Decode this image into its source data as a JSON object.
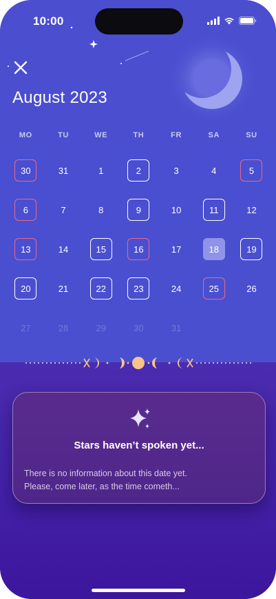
{
  "status_bar": {
    "time": "10:00"
  },
  "header": {
    "title": "August 2023",
    "close_icon": "close-icon"
  },
  "calendar": {
    "weekdays": [
      "MO",
      "TU",
      "WE",
      "TH",
      "FR",
      "SA",
      "SU"
    ],
    "weeks": [
      [
        {
          "d": "30",
          "s": "red"
        },
        {
          "d": "31",
          "s": "plain"
        },
        {
          "d": "1",
          "s": "plain"
        },
        {
          "d": "2",
          "s": "white"
        },
        {
          "d": "3",
          "s": "plain"
        },
        {
          "d": "4",
          "s": "plain"
        },
        {
          "d": "5",
          "s": "red"
        }
      ],
      [
        {
          "d": "6",
          "s": "red"
        },
        {
          "d": "7",
          "s": "plain"
        },
        {
          "d": "8",
          "s": "plain"
        },
        {
          "d": "9",
          "s": "white"
        },
        {
          "d": "10",
          "s": "plain"
        },
        {
          "d": "11",
          "s": "white"
        },
        {
          "d": "12",
          "s": "plain"
        }
      ],
      [
        {
          "d": "13",
          "s": "red"
        },
        {
          "d": "14",
          "s": "plain"
        },
        {
          "d": "15",
          "s": "white"
        },
        {
          "d": "16",
          "s": "red"
        },
        {
          "d": "17",
          "s": "plain"
        },
        {
          "d": "18",
          "s": "selected"
        },
        {
          "d": "19",
          "s": "white"
        }
      ],
      [
        {
          "d": "20",
          "s": "white"
        },
        {
          "d": "21",
          "s": "plain"
        },
        {
          "d": "22",
          "s": "white"
        },
        {
          "d": "23",
          "s": "white"
        },
        {
          "d": "24",
          "s": "plain"
        },
        {
          "d": "25",
          "s": "red"
        },
        {
          "d": "26",
          "s": "plain"
        }
      ],
      [
        {
          "d": "27",
          "s": "faded"
        },
        {
          "d": "28",
          "s": "faded"
        },
        {
          "d": "29",
          "s": "faded"
        },
        {
          "d": "30",
          "s": "faded"
        },
        {
          "d": "31",
          "s": "faded"
        }
      ]
    ],
    "selected_day": "18"
  },
  "message_card": {
    "icon": "sparkle-icon",
    "title": "Stars haven’t spoken yet...",
    "body_line1": "There is no information about this date yet.",
    "body_line2": "Please, come later, as the time cometh..."
  },
  "colors": {
    "background_top": "#4b4ecf",
    "background_bottom": "#3c169c",
    "accent_red": "#e56a8a",
    "selected": "#8f94e8",
    "moon": "#9fa4f0",
    "gold": "#f6c48a"
  }
}
